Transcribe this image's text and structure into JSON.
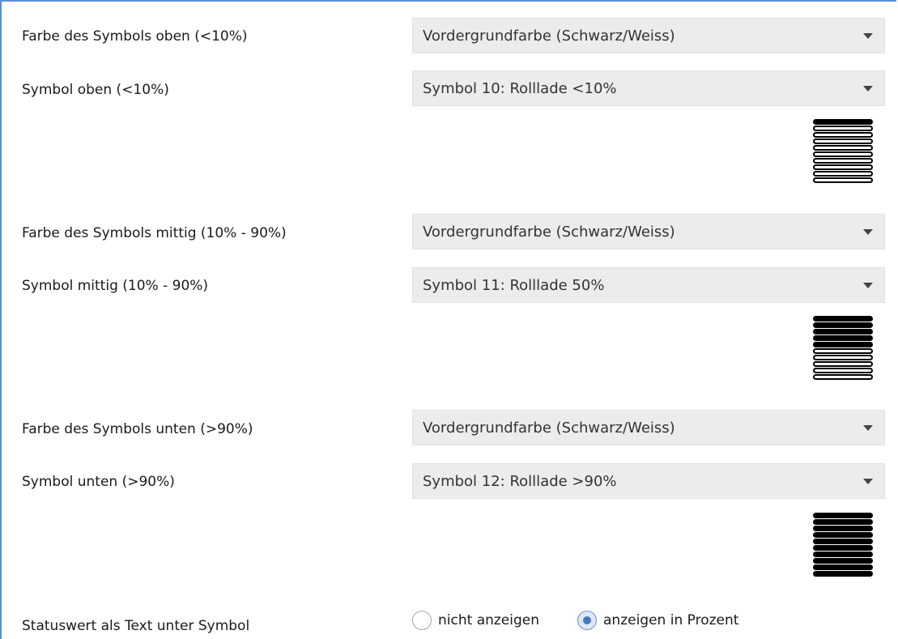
{
  "rows": [
    {
      "label": "Farbe des Symbols oben (<10%)",
      "value": "Vordergrundfarbe (Schwarz/Weiss)"
    },
    {
      "label": "Symbol oben (<10%)",
      "value": "Symbol 10: Rolllade <10%"
    },
    {
      "label": "Farbe des Symbols mittig (10% - 90%)",
      "value": "Vordergrundfarbe (Schwarz/Weiss)"
    },
    {
      "label": "Symbol mittig (10% - 90%)",
      "value": "Symbol 11: Rolllade 50%"
    },
    {
      "label": "Farbe des Symbols unten (>90%)",
      "value": "Vordergrundfarbe (Schwarz/Weiss)"
    },
    {
      "label": "Symbol unten (>90%)",
      "value": "Symbol 12: Rolllade >90%"
    }
  ],
  "previews": [
    {
      "icon": "shutter-closed-under-10-icon",
      "closed_fraction": 0.1
    },
    {
      "icon": "shutter-half-icon",
      "closed_fraction": 0.5
    },
    {
      "icon": "shutter-full-icon",
      "closed_fraction": 1.0
    }
  ],
  "status": {
    "label": "Statuswert als Text unter Symbol",
    "options": [
      "nicht anzeigen",
      "anzeigen in Prozent"
    ],
    "selected": "anzeigen in Prozent"
  },
  "colors": {
    "accent": "#4a78b8",
    "dropdown_bg": "#ececec",
    "frame_border": "#5b8fd6"
  }
}
